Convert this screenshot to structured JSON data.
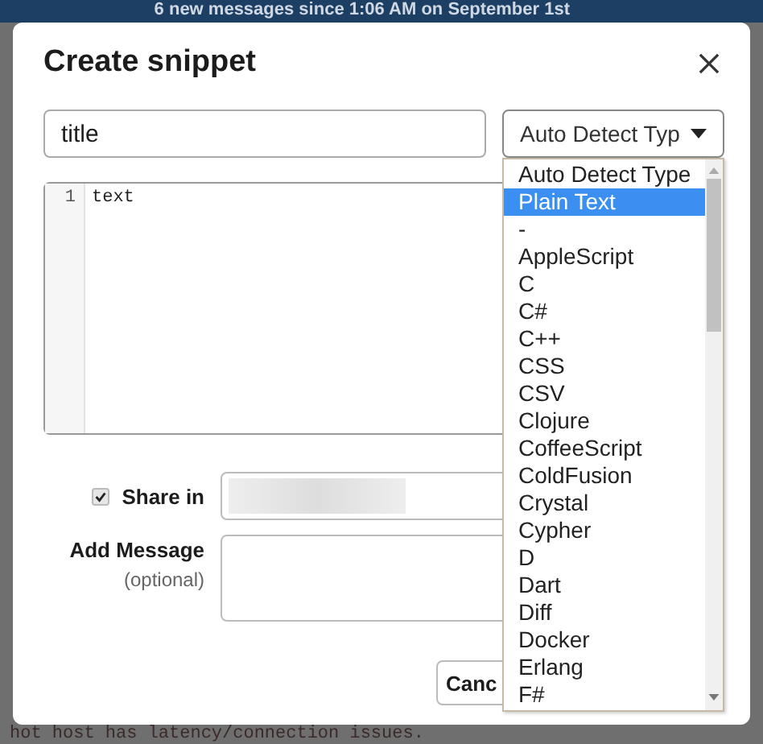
{
  "background": {
    "banner": "6 new messages since 1:06 AM on September 1st",
    "code_line": "hot host has latency/connection issues."
  },
  "dialog": {
    "title": "Create snippet",
    "title_field": {
      "value": "title"
    },
    "type_select": {
      "value": "Auto Detect Typ",
      "expanded": true
    },
    "editor": {
      "lines": [
        {
          "number": "1",
          "text": "text"
        }
      ]
    },
    "share": {
      "checked": true,
      "label": "Share in"
    },
    "message": {
      "label": "Add Message",
      "hint": "(optional)"
    },
    "buttons": [
      {
        "label": "Canc"
      }
    ],
    "type_options": [
      {
        "label": "Auto Detect Type",
        "selected": false
      },
      {
        "label": "Plain Text",
        "selected": true
      },
      {
        "label": "-",
        "selected": false
      },
      {
        "label": "AppleScript",
        "selected": false
      },
      {
        "label": "C",
        "selected": false
      },
      {
        "label": "C#",
        "selected": false
      },
      {
        "label": "C++",
        "selected": false
      },
      {
        "label": "CSS",
        "selected": false
      },
      {
        "label": "CSV",
        "selected": false
      },
      {
        "label": "Clojure",
        "selected": false
      },
      {
        "label": "CoffeeScript",
        "selected": false
      },
      {
        "label": "ColdFusion",
        "selected": false
      },
      {
        "label": "Crystal",
        "selected": false
      },
      {
        "label": "Cypher",
        "selected": false
      },
      {
        "label": "D",
        "selected": false
      },
      {
        "label": "Dart",
        "selected": false
      },
      {
        "label": "Diff",
        "selected": false
      },
      {
        "label": "Docker",
        "selected": false
      },
      {
        "label": "Erlang",
        "selected": false
      },
      {
        "label": "F#",
        "selected": false
      }
    ]
  }
}
